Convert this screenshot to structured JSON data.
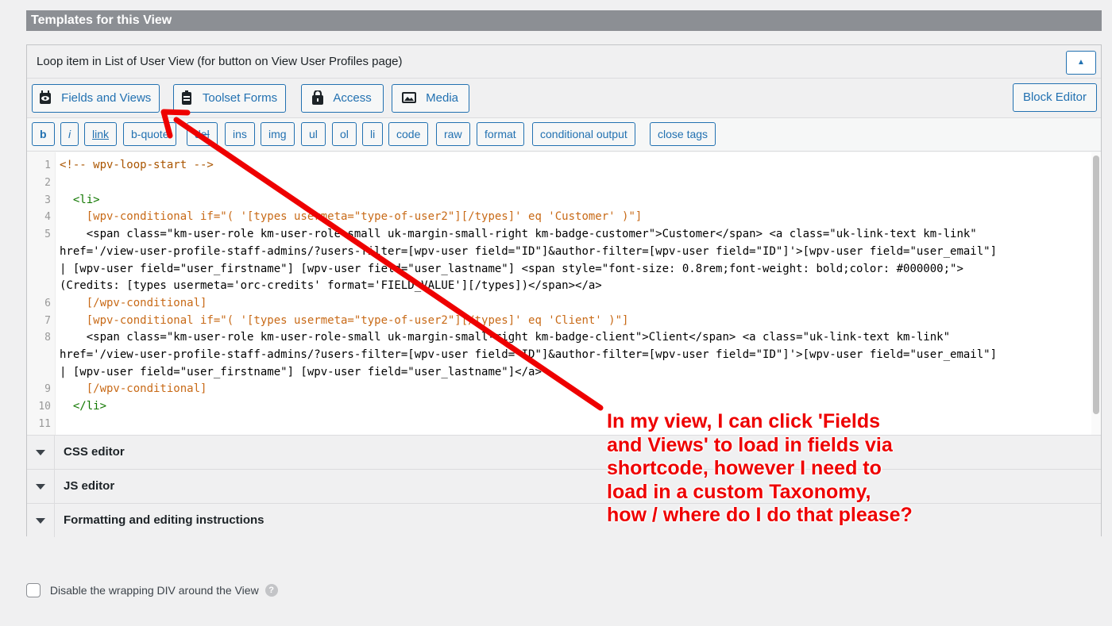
{
  "section": {
    "title": "Templates for this View"
  },
  "panel": {
    "title": "Loop item in List of User View (for button on View User Profiles page)",
    "toggle_icon": "chevron-up-icon"
  },
  "toolbar": {
    "fields_views": "Fields and Views",
    "toolset_forms": "Toolset Forms",
    "access": "Access",
    "media": "Media",
    "block_editor": "Block Editor"
  },
  "quicktags": [
    "b",
    "i",
    "link",
    "b-quote",
    "del",
    "ins",
    "img",
    "ul",
    "ol",
    "li",
    "code",
    "raw",
    "format",
    "conditional output",
    "close tags"
  ],
  "editor": {
    "line_numbers": [
      "1",
      "2",
      "3",
      "4",
      "5",
      "6",
      "7",
      "8",
      "9",
      "10",
      "11"
    ],
    "code": [
      "<!-- wpv-loop-start -->",
      "",
      "  <li>",
      "    [wpv-conditional if=\"( '[types usermeta=\"type-of-user2\"][/types]' eq 'Customer' )\"]",
      "    <span class=\"km-user-role km-user-role-small uk-margin-small-right km-badge-customer\">Customer</span> <a class=\"uk-link-text km-link\"",
      "href='/view-user-profile-staff-admins/?users-filter=[wpv-user field=\"ID\"]&author-filter=[wpv-user field=\"ID\"]'>[wpv-user field=\"user_email\"]",
      "| [wpv-user field=\"user_firstname\"] [wpv-user field=\"user_lastname\"] <span style=\"font-size: 0.8rem;font-weight: bold;color: #000000;\">",
      "(Credits: [types usermeta='orc-credits' format='FIELD_VALUE'][/types])</span></a>",
      "    [/wpv-conditional]",
      "    [wpv-conditional if=\"( '[types usermeta=\"type-of-user2\"][/types]' eq 'Client' )\"]",
      "    <span class=\"km-user-role km-user-role-small uk-margin-small-right km-badge-client\">Client</span> <a class=\"uk-link-text km-link\"",
      "href='/view-user-profile-staff-admins/?users-filter=[wpv-user field=\"ID\"]&author-filter=[wpv-user field=\"ID\"]'>[wpv-user field=\"user_email\"]",
      "| [wpv-user field=\"user_firstname\"] [wpv-user field=\"user_lastname\"]</a>",
      "    [/wpv-conditional]",
      "  </li>",
      ""
    ]
  },
  "accordions": {
    "css": "CSS editor",
    "js": "JS editor",
    "formatting": "Formatting and editing instructions"
  },
  "options": {
    "disable_wrapping": "Disable the wrapping DIV around the View",
    "help": "?"
  },
  "annotation": {
    "lines": [
      "In my view, I can click 'Fields",
      "and Views' to load in fields via",
      "shortcode, however I need to",
      "load in a custom Taxonomy,",
      "how / where do I do that please?"
    ],
    "color": "#ee0000"
  },
  "colors": {
    "accent": "#2271b1",
    "header_bg": "#8c8f94"
  }
}
